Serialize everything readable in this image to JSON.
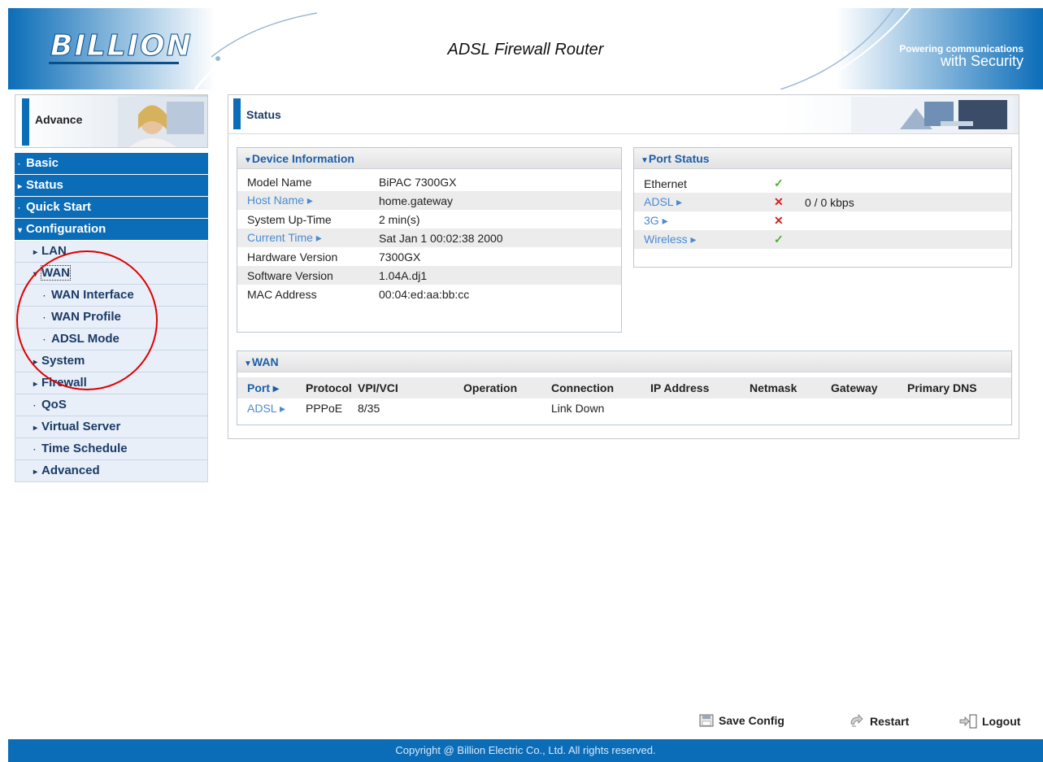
{
  "header": {
    "logo": "BILLION",
    "title": "ADSL Firewall Router",
    "tagline_line1": "Powering communications",
    "tagline_line2": "with Security"
  },
  "sidebar": {
    "section": "Advance",
    "items": [
      {
        "label": "Basic",
        "marker": "·"
      },
      {
        "label": "Status",
        "marker": "▸"
      },
      {
        "label": "Quick Start",
        "marker": "·"
      },
      {
        "label": "Configuration",
        "marker": "▾"
      },
      {
        "label": "LAN",
        "marker": "▸"
      },
      {
        "label": "WAN",
        "marker": "▾"
      },
      {
        "label": "WAN Interface",
        "marker": "·"
      },
      {
        "label": "WAN Profile",
        "marker": "·"
      },
      {
        "label": "ADSL Mode",
        "marker": "·"
      },
      {
        "label": "System",
        "marker": "▸"
      },
      {
        "label": "Firewall",
        "marker": "▸"
      },
      {
        "label": "QoS",
        "marker": "·"
      },
      {
        "label": "Virtual Server",
        "marker": "▸"
      },
      {
        "label": "Time Schedule",
        "marker": "·"
      },
      {
        "label": "Advanced",
        "marker": "▸"
      }
    ]
  },
  "main": {
    "status_title": "Status",
    "device_info": {
      "title": "Device Information",
      "rows": [
        {
          "key": "Model Name",
          "value": "BiPAC 7300GX"
        },
        {
          "key": "Host Name ▸",
          "value": "home.gateway"
        },
        {
          "key": "System Up-Time",
          "value": "2 min(s)"
        },
        {
          "key": "Current Time ▸",
          "value": "Sat Jan 1 00:02:38 2000"
        },
        {
          "key": "Hardware Version",
          "value": "7300GX"
        },
        {
          "key": "Software Version",
          "value": "1.04A.dj1"
        },
        {
          "key": "MAC Address",
          "value": "00:04:ed:aa:bb:cc"
        }
      ]
    },
    "port_status": {
      "title": "Port Status",
      "rows": [
        {
          "port": "Ethernet",
          "state": "✓",
          "info": ""
        },
        {
          "port": "ADSL ▸",
          "state": "✕",
          "info": "0 / 0 kbps"
        },
        {
          "port": "3G ▸",
          "state": "✕",
          "info": ""
        },
        {
          "port": "Wireless ▸",
          "state": "✓",
          "info": ""
        }
      ]
    },
    "wan": {
      "title": "WAN",
      "headers": [
        "Port ▸",
        "Protocol",
        "VPI/VCI",
        "Operation",
        "Connection",
        "IP Address",
        "Netmask",
        "Gateway",
        "Primary DNS"
      ],
      "row": [
        "ADSL ▸",
        "PPPoE",
        "8/35",
        "",
        "Link Down",
        "",
        "",
        "",
        ""
      ]
    }
  },
  "actions": {
    "save": "Save Config",
    "restart": "Restart",
    "logout": "Logout"
  },
  "footer": {
    "copyright": "Copyright @ Billion Electric Co., Ltd. All rights reserved."
  },
  "colors": {
    "brand_blue": "#0b6db8",
    "link_blue": "#4a8ad1",
    "ok_green": "#4caf2a",
    "error_red": "#d61f1f",
    "highlight_circle": "#e00000"
  }
}
